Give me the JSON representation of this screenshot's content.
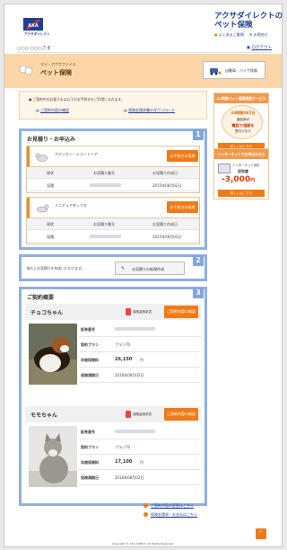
{
  "header": {
    "brand_text": "アクサダイレクト",
    "site_title": "アクサダイレクトのペット保険",
    "faq_label": "よくあるご質問",
    "contact_label": "お問合せ",
    "greeting": "○○○ ○○○さま",
    "logout_label": "ログアウト"
  },
  "band": {
    "subtitle": "マイ・アクサファイル",
    "title": "ペット保険",
    "switch_button": "自動車・バイク保険"
  },
  "notice": {
    "text": "ご契約中のお客さまは以下のお手続きをご利用になれます。",
    "link1": "ご契約内容の確認",
    "link2": "保険金請求書のダウンロード"
  },
  "section1": {
    "title": "お見積り・お申込み",
    "number": "1",
    "cards": [
      {
        "pet_name": "アメリカン・ショートヘア",
        "button": "お手続きの再開",
        "headers": [
          "現状",
          "お見積り番号",
          "お見積り作成日"
        ],
        "row": [
          "見積",
          "",
          "2015年08月02日"
        ]
      },
      {
        "pet_name": "ミニチュアダックス",
        "button": "お手続きの再開",
        "headers": [
          "現状",
          "お見積り番号",
          "お見積り作成日"
        ],
        "row": [
          "見積",
          "",
          "2015年08月02日"
        ]
      }
    ]
  },
  "section2": {
    "number": "2",
    "text": "新たにお見積りを作成いただけます。",
    "button": "お見積りの新規作成"
  },
  "section3": {
    "title": "ご契約概要",
    "number": "3",
    "pets": [
      {
        "name": "チョコちゃん",
        "claim_label": "保険金請求書",
        "detail_button": "ご契約内容の確認",
        "fields": [
          {
            "k": "証券番号",
            "v": ""
          },
          {
            "k": "契約プラン",
            "v": "プラン70"
          },
          {
            "k": "年間保険料",
            "v": "26,150",
            "unit": "円"
          },
          {
            "k": "保険満期日",
            "v": "2016年08月02日"
          }
        ]
      },
      {
        "name": "モモちゃん",
        "claim_label": "保険金請求書",
        "detail_button": "ご契約内容の確認",
        "fields": [
          {
            "k": "証券番号",
            "v": ""
          },
          {
            "k": "契約プラン",
            "v": "プラン70"
          },
          {
            "k": "年間保険料",
            "v": "17,100",
            "unit": "円"
          },
          {
            "k": "保険満期日",
            "v": "2016年08月02日"
          }
        ]
      }
    ]
  },
  "sidebar": {
    "card1_head": "24時間ペット健康相談サービス",
    "card1_line1": "24時間365日",
    "card1_line2": "獣医師が",
    "card1_line3": "電話で相談を",
    "card1_line4": "受付けます",
    "card1_button": "詳しくはこちら",
    "card2_head": "インターネットでお申込みなら",
    "card2_line1": "インターネット割引",
    "card2_line2": "初年度",
    "card2_line3": "-3,000",
    "card2_unit": "円",
    "card2_button": "詳しくはこちら"
  },
  "footer": {
    "link1": "ご契約内容の変更はこちら",
    "link2": "保険金請求・お支払はこちら",
    "copyright": "Copyright © AXA DIRECT. All Rights Reserved."
  },
  "colors": {
    "accent": "#f07b16",
    "brand": "#1d3f8f",
    "section_border": "#8fb0e0"
  }
}
